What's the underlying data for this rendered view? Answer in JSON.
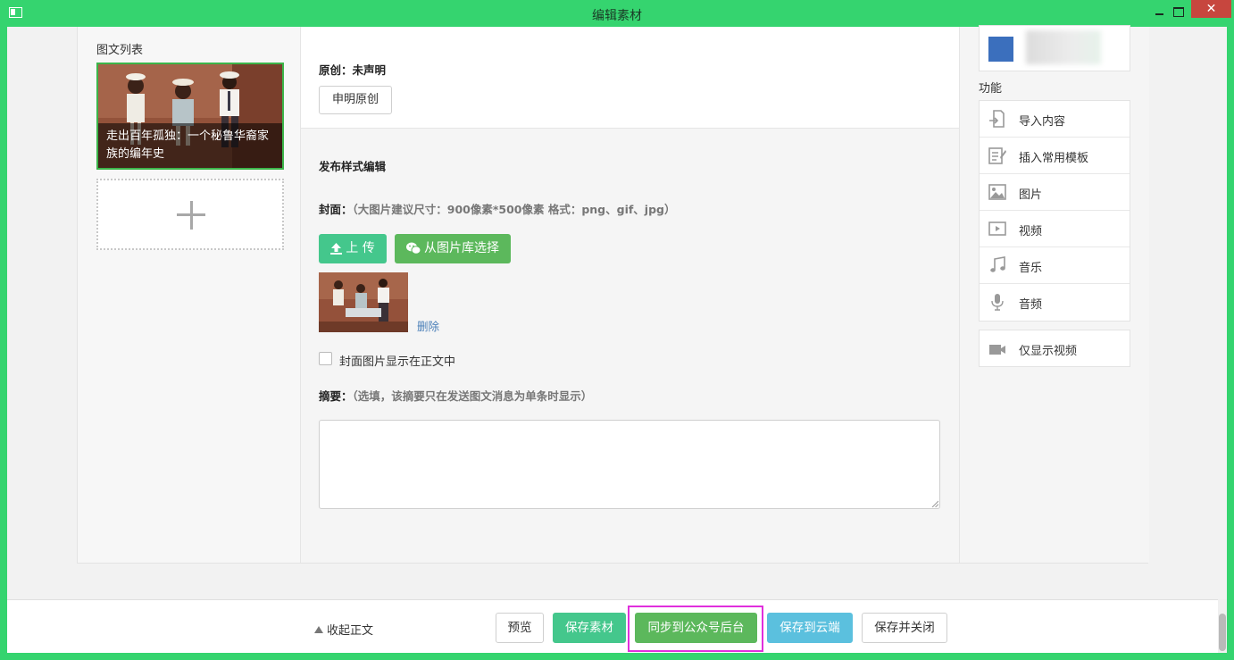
{
  "window": {
    "title": "编辑素材",
    "close_glyph": "✕"
  },
  "left": {
    "list_title": "图文列表",
    "article_title": "走出百年孤独：一个秘鲁华裔家族的编年史"
  },
  "middle": {
    "original_label": "原创：未声明",
    "declare_button": "申明原创",
    "publish_title": "发布样式编辑",
    "cover_label": "封面：",
    "cover_hint": "（大图片建议尺寸：900像素*500像素 格式：png、gif、jpg）",
    "upload_button": "上 传",
    "library_button": "从图片库选择",
    "delete_link": "删除",
    "show_cover_label": "封面图片显示在正文中",
    "summary_label": "摘要：",
    "summary_hint": "（选填，该摘要只在发送图文消息为单条时显示）",
    "summary_value": ""
  },
  "right": {
    "func_title": "功能",
    "items": [
      {
        "label": "导入内容",
        "icon": "import-icon"
      },
      {
        "label": "插入常用模板",
        "icon": "template-icon"
      },
      {
        "label": "图片",
        "icon": "image-icon"
      },
      {
        "label": "视频",
        "icon": "video-icon"
      },
      {
        "label": "音乐",
        "icon": "music-icon"
      },
      {
        "label": "音频",
        "icon": "microphone-icon"
      }
    ],
    "video_only": "仅显示视频"
  },
  "footer": {
    "collapse": "收起正文",
    "preview": "预览",
    "save": "保存素材",
    "sync": "同步到公众号后台",
    "save_cloud": "保存到云端",
    "save_close": "保存并关闭"
  },
  "colors": {
    "window_chrome": "#35d46f",
    "save_green": "#44c78c",
    "sync_green": "#5cb85c",
    "cloud_blue": "#5bc0de",
    "highlight": "#e02fdc",
    "close_red": "#c7463e"
  }
}
